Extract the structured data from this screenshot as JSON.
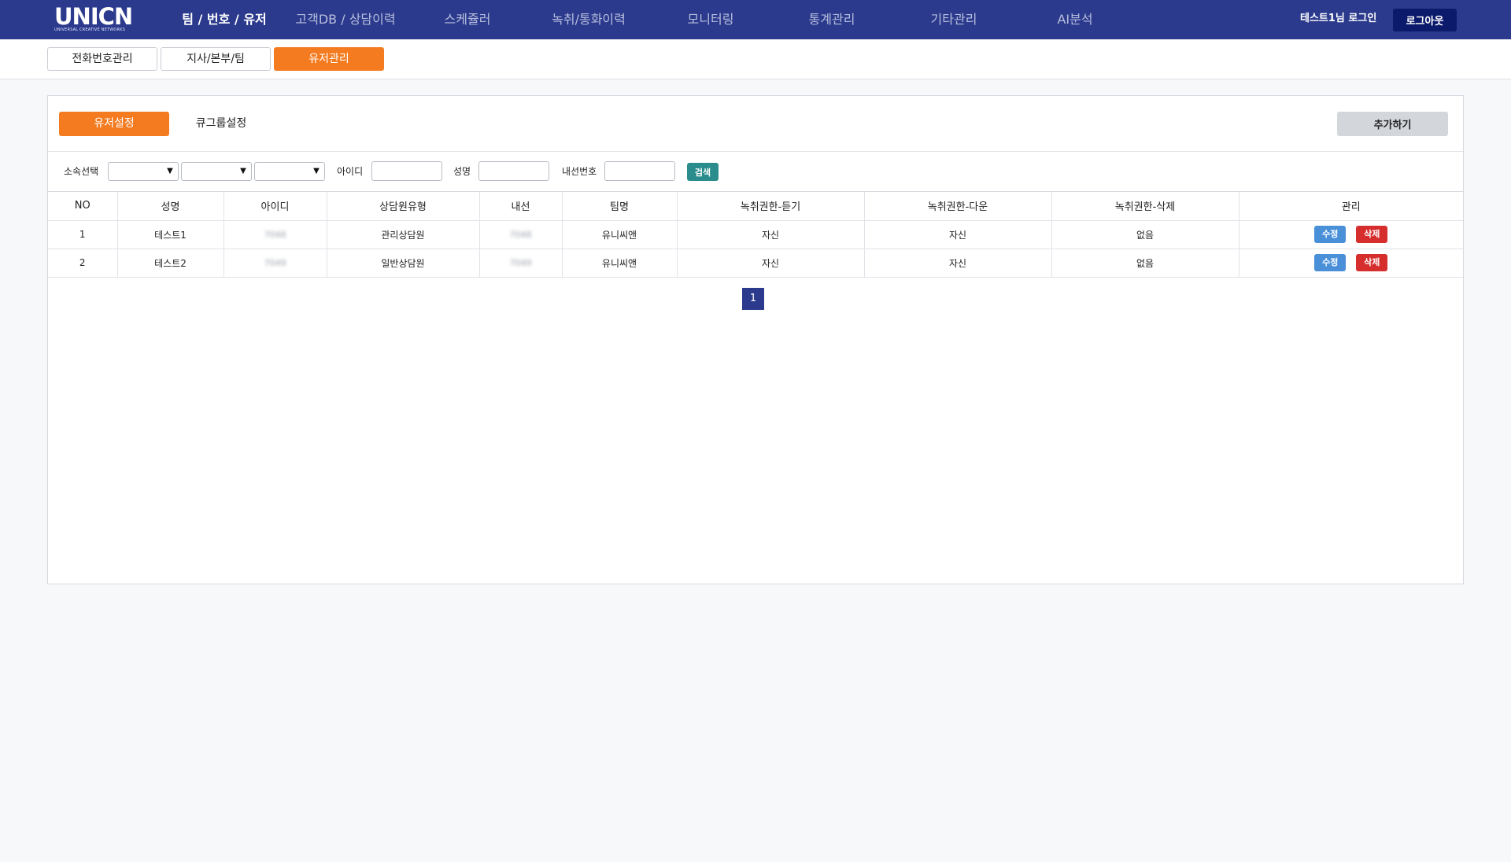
{
  "brand": {
    "logo": "UNICN",
    "tagline": "UNIVERSAL CREATIVE NETWORKS"
  },
  "nav": {
    "items": [
      {
        "label": "팀 / 번호 / 유저",
        "active": true
      },
      {
        "label": "고객DB / 상담이력"
      },
      {
        "label": "스케쥴러"
      },
      {
        "label": "녹취/통화이력"
      },
      {
        "label": "모니터링"
      },
      {
        "label": "통계관리"
      },
      {
        "label": "기타관리"
      },
      {
        "label": "AI분석"
      }
    ],
    "login_user": "테스트1님 로그인",
    "logout": "로그아웃"
  },
  "subtabs": [
    {
      "label": "전화번호관리"
    },
    {
      "label": "지사/본부/팀"
    },
    {
      "label": "유저관리",
      "active": true
    }
  ],
  "panel": {
    "tabs": [
      {
        "label": "유저설정",
        "active": true
      },
      {
        "label": "큐그룹설정"
      }
    ],
    "add_button": "추가하기"
  },
  "filter": {
    "affiliation_label": "소속선택",
    "selects": [
      "",
      "",
      ""
    ],
    "id_label": "아이디",
    "id_value": "",
    "name_label": "성명",
    "name_value": "",
    "ext_label": "내선번호",
    "ext_value": "",
    "search_button": "검색"
  },
  "table": {
    "headers": [
      "NO",
      "성명",
      "아이디",
      "상담원유형",
      "내선",
      "팀명",
      "녹취권한-듣기",
      "녹취권한-다운",
      "녹취권한-삭제",
      "관리"
    ],
    "rows": [
      {
        "no": "1",
        "name": "테스트1",
        "id": "7048",
        "type": "관리상담원",
        "ext": "7048",
        "team": "유니씨앤",
        "listen": "자신",
        "download": "자신",
        "delete": "없음",
        "edit": "수정",
        "remove": "삭제"
      },
      {
        "no": "2",
        "name": "테스트2",
        "id": "7049",
        "type": "일반상담원",
        "ext": "7049",
        "team": "유니씨앤",
        "listen": "자신",
        "download": "자신",
        "delete": "없음",
        "edit": "수정",
        "remove": "삭제"
      }
    ]
  },
  "pagination": {
    "current": "1"
  },
  "colors": {
    "nav_bg": "#2b3a8c",
    "accent_orange": "#f47b20",
    "logout_bg": "#0c1a6b",
    "search_teal": "#2a8c8c",
    "edit_blue": "#4a90d9",
    "delete_red": "#d62d2d"
  }
}
